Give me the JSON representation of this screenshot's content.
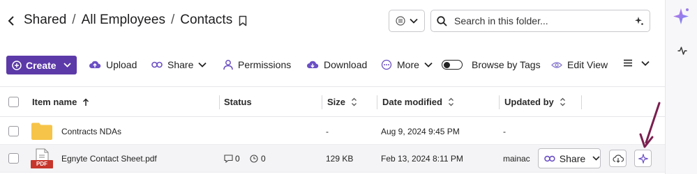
{
  "breadcrumb": {
    "items": [
      "Shared",
      "All Employees",
      "Contacts"
    ],
    "separator": "/"
  },
  "search": {
    "placeholder": "Search in this folder..."
  },
  "toolbar": {
    "create": "Create",
    "upload": "Upload",
    "share": "Share",
    "permissions": "Permissions",
    "download": "Download",
    "more": "More",
    "browse_by_tags": "Browse by Tags",
    "edit_view": "Edit View"
  },
  "table": {
    "columns": {
      "name": "Item name",
      "status": "Status",
      "size": "Size",
      "date": "Date modified",
      "updated_by": "Updated by"
    },
    "rows": [
      {
        "name": "Contracts NDAs",
        "type": "folder",
        "status_comments": "",
        "status_tasks": "",
        "size": "-",
        "date": "Aug 9, 2024 9:45 PM",
        "updated_by": "-"
      },
      {
        "name": "Egnyte Contact Sheet.pdf",
        "type": "pdf",
        "file_badge": "PDF",
        "status_comments": "0",
        "status_tasks": "0",
        "size": "129 KB",
        "date": "Feb 13, 2024 8:11 PM",
        "updated_by": "mainac",
        "share_label": "Share"
      }
    ]
  },
  "colors": {
    "accent": "#5c3aa8",
    "folder": "#f6c449",
    "pdf_badge": "#c6362c",
    "arrow": "#7a1f4f",
    "icon": "#6b4fc4"
  },
  "icons": [
    "back-chevron",
    "bookmark",
    "view-selector",
    "search",
    "sparkle",
    "upload-cloud",
    "link",
    "user-permissions",
    "download-cloud",
    "more-dots",
    "toggle",
    "eye",
    "list",
    "folder",
    "pdf",
    "comment",
    "clock",
    "cloud-download",
    "pulse"
  ]
}
